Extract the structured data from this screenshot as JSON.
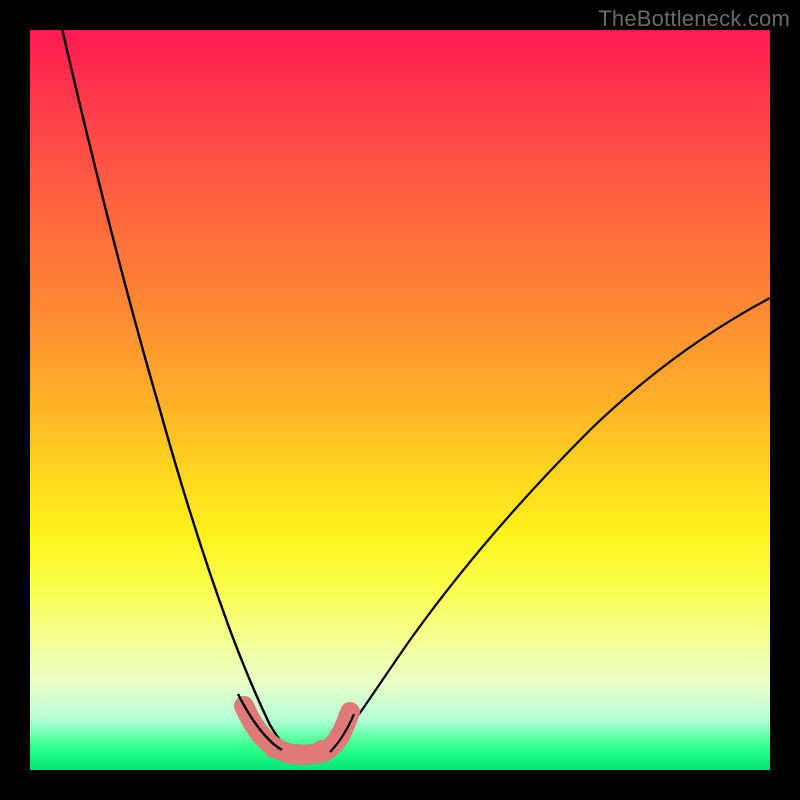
{
  "watermark": "TheBottleneck.com",
  "chart_data": {
    "type": "line",
    "title": "",
    "xlabel": "",
    "ylabel": "",
    "xlim": [
      0,
      100
    ],
    "ylim": [
      0,
      100
    ],
    "grid": false,
    "legend": false,
    "series": [
      {
        "name": "left-curve",
        "x": [
          4,
          6,
          8,
          10,
          12,
          14,
          16,
          18,
          20,
          22,
          24,
          26,
          28,
          30,
          32,
          33,
          34
        ],
        "y": [
          100,
          89,
          79,
          69,
          60,
          52,
          44,
          37,
          30,
          24,
          18,
          13,
          9,
          6,
          4,
          3,
          3
        ]
      },
      {
        "name": "right-curve",
        "x": [
          39,
          41,
          44,
          48,
          52,
          58,
          64,
          70,
          76,
          82,
          88,
          94,
          100
        ],
        "y": [
          3,
          4,
          7,
          12,
          17,
          24,
          31,
          37,
          43,
          49,
          54,
          59,
          64
        ]
      },
      {
        "name": "bottom-marker-band",
        "x": [
          28,
          29,
          30,
          31,
          32,
          33,
          34,
          35,
          36,
          37,
          38,
          39,
          40
        ],
        "y": [
          7,
          5.5,
          4.5,
          3.8,
          3.4,
          3.2,
          3.2,
          3.2,
          3.4,
          3.8,
          4.5,
          5.5,
          7
        ]
      }
    ],
    "marker_color": "#e07a78",
    "curve_color": "#000000"
  }
}
